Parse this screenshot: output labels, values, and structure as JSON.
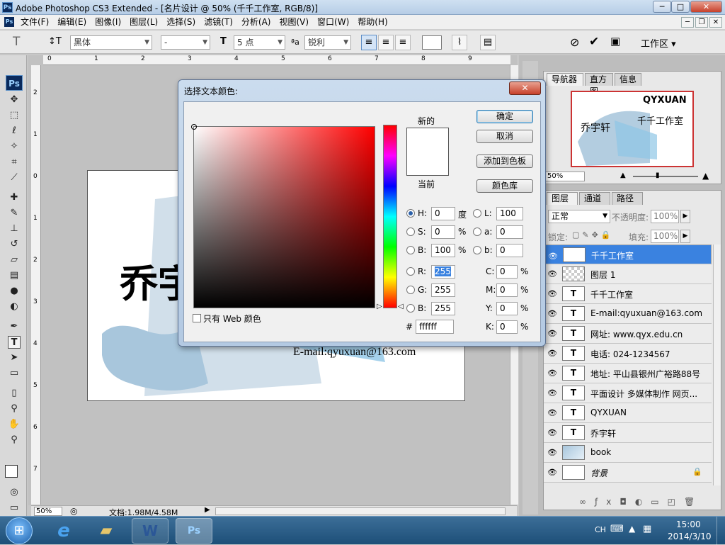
{
  "window": {
    "title": "Adobe Photoshop CS3 Extended - [名片设计 @ 50% (千千工作室, RGB/8)]",
    "app_icon": "Ps",
    "min_label": "─",
    "max_label": "□",
    "close_label": "✕"
  },
  "menu": {
    "items": [
      "文件(F)",
      "编辑(E)",
      "图像(I)",
      "图层(L)",
      "选择(S)",
      "滤镜(T)",
      "分析(A)",
      "视图(V)",
      "窗口(W)",
      "帮助(H)"
    ]
  },
  "options_bar": {
    "tool_glyph": "T",
    "font_family": "黑体",
    "font_style": "-",
    "font_size": "5 点",
    "aa_label": "ªa",
    "antialias": "锐利",
    "workspace_label": "工作区 ▾"
  },
  "rulers": {
    "h_ticks": [
      "0",
      "1",
      "2",
      "3",
      "4",
      "5",
      "6",
      "7",
      "8",
      "9"
    ],
    "v_ticks": [
      "2",
      "1",
      "0",
      "1",
      "2",
      "3",
      "4",
      "5",
      "6",
      "7"
    ]
  },
  "canvas_text": {
    "name_partial": "乔宇",
    "email": "E-mail:qyuxuan@163.com"
  },
  "status": {
    "zoom": "50%",
    "doc_info": "文档:1.98M/4.58M"
  },
  "navigator": {
    "tabs": [
      "导航器",
      "直方图",
      "信息"
    ],
    "zoom": "50%",
    "preview_brand": "QYXUAN",
    "preview_studio": "千千工作室",
    "preview_name": "乔宇轩"
  },
  "layers_panel": {
    "tabs": [
      "图层",
      "通道",
      "路径"
    ],
    "blend_mode": "正常",
    "opacity_label": "不透明度:",
    "opacity_value": "100%",
    "lock_label": "锁定:",
    "fill_label": "填充:",
    "fill_value": "100%",
    "layers": [
      {
        "name": "千千工作室",
        "kind": "T",
        "selected": true
      },
      {
        "name": "图层 1",
        "kind": "raster",
        "selected": false
      },
      {
        "name": "千千工作室",
        "kind": "T",
        "selected": false
      },
      {
        "name": "E-mail:qyuxuan@163.com",
        "kind": "T",
        "selected": false
      },
      {
        "name": "网址: www.qyx.edu.cn",
        "kind": "T",
        "selected": false
      },
      {
        "name": "电话: 024-1234567",
        "kind": "T",
        "selected": false
      },
      {
        "name": "地址: 平山县银州广裕路88号",
        "kind": "T",
        "selected": false
      },
      {
        "name": "平面设计 多媒体制作 网页...",
        "kind": "T",
        "selected": false
      },
      {
        "name": "QYXUAN",
        "kind": "T",
        "selected": false
      },
      {
        "name": "乔宇轩",
        "kind": "T",
        "selected": false
      },
      {
        "name": "book",
        "kind": "smart",
        "selected": false
      },
      {
        "name": "背景",
        "kind": "background",
        "selected": false
      }
    ]
  },
  "color_dialog": {
    "title": "选择文本颜色:",
    "new_label": "新的",
    "current_label": "当前",
    "ok": "确定",
    "cancel": "取消",
    "add_swatch": "添加到色板",
    "color_lib": "颜色库",
    "web_only": "只有 Web 颜色",
    "hsb": [
      {
        "label": "H:",
        "value": "0",
        "unit": "度",
        "checked": true
      },
      {
        "label": "S:",
        "value": "0",
        "unit": "%",
        "checked": false
      },
      {
        "label": "B:",
        "value": "100",
        "unit": "%",
        "checked": false
      }
    ],
    "rgb": [
      {
        "label": "R:",
        "value": "255",
        "checked": false
      },
      {
        "label": "G:",
        "value": "255",
        "checked": false
      },
      {
        "label": "B:",
        "value": "255",
        "checked": false
      }
    ],
    "lab": [
      {
        "label": "L:",
        "value": "100"
      },
      {
        "label": "a:",
        "value": "0"
      },
      {
        "label": "b:",
        "value": "0"
      }
    ],
    "cmyk": [
      {
        "label": "C:",
        "value": "0",
        "unit": "%"
      },
      {
        "label": "M:",
        "value": "0",
        "unit": "%"
      },
      {
        "label": "Y:",
        "value": "0",
        "unit": "%"
      },
      {
        "label": "K:",
        "value": "0",
        "unit": "%"
      }
    ],
    "hex_label": "#",
    "hex_value": "ffffff",
    "picked_color": "#ffffff",
    "field_hue_color": "#ff0000"
  },
  "taskbar": {
    "lang": "CH",
    "time": "15:00",
    "date": "2014/3/10"
  }
}
